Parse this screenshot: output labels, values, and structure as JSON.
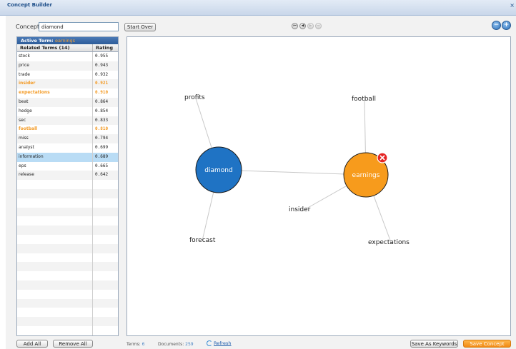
{
  "window": {
    "title": "Concept Builder",
    "close_glyph": "×"
  },
  "concept": {
    "label": "Concept:",
    "value": "diamond"
  },
  "toolbar": {
    "start_over": "Start Over",
    "nav_buttons": [
      "first-icon",
      "prev-icon",
      "next-icon",
      "last-icon"
    ],
    "zoom_out_glyph": "−",
    "zoom_in_glyph": "+"
  },
  "related": {
    "active_term_label": "Active Term:",
    "active_term_value": "earnings",
    "header_terms": "Related Terms (14)",
    "header_rating": "Rating",
    "rows": [
      {
        "term": "stock",
        "rating": "0.955",
        "state": "normal"
      },
      {
        "term": "price",
        "rating": "0.943",
        "state": "normal"
      },
      {
        "term": "trade",
        "rating": "0.932",
        "state": "normal"
      },
      {
        "term": "insider",
        "rating": "0.921",
        "state": "highlight"
      },
      {
        "term": "expectations",
        "rating": "0.910",
        "state": "highlight"
      },
      {
        "term": "beat",
        "rating": "0.864",
        "state": "normal"
      },
      {
        "term": "hedge",
        "rating": "0.854",
        "state": "normal"
      },
      {
        "term": "sec",
        "rating": "0.833",
        "state": "normal"
      },
      {
        "term": "football",
        "rating": "0.810",
        "state": "highlight"
      },
      {
        "term": "miss",
        "rating": "0.794",
        "state": "normal"
      },
      {
        "term": "analyst",
        "rating": "0.699",
        "state": "normal"
      },
      {
        "term": "information",
        "rating": "0.689",
        "state": "selected"
      },
      {
        "term": "eps",
        "rating": "0.665",
        "state": "normal"
      },
      {
        "term": "release",
        "rating": "0.642",
        "state": "normal"
      }
    ],
    "add_all": "Add All",
    "remove_all": "Remove All"
  },
  "graph": {
    "nodes": [
      {
        "id": "diamond",
        "label": "diamond",
        "kind": "concept",
        "color": "#1f73c4"
      },
      {
        "id": "earnings",
        "label": "earnings",
        "kind": "active",
        "color": "#f79b1c"
      },
      {
        "id": "profits",
        "label": "profits",
        "kind": "term"
      },
      {
        "id": "forecast",
        "label": "forecast",
        "kind": "term"
      },
      {
        "id": "football",
        "label": "football",
        "kind": "term"
      },
      {
        "id": "insider",
        "label": "insider",
        "kind": "term"
      },
      {
        "id": "expectations",
        "label": "expectations",
        "kind": "term"
      }
    ],
    "edges": [
      [
        "diamond",
        "earnings"
      ],
      [
        "diamond",
        "profits"
      ],
      [
        "diamond",
        "forecast"
      ],
      [
        "earnings",
        "football"
      ],
      [
        "earnings",
        "insider"
      ],
      [
        "earnings",
        "expectations"
      ]
    ],
    "remove_icon": "close-circle-icon"
  },
  "status": {
    "terms_label": "Terms:",
    "terms_value": "6",
    "documents_label": "Documents:",
    "documents_value": "259",
    "refresh": "Refresh"
  },
  "footer": {
    "save_keywords": "Save As Keywords",
    "save_concept": "Save Concept"
  },
  "colors": {
    "accent": "#f79b1c",
    "concept_node": "#1f73c4",
    "selected_row": "#b9dcf5",
    "highlight_text": "#f39a24"
  }
}
